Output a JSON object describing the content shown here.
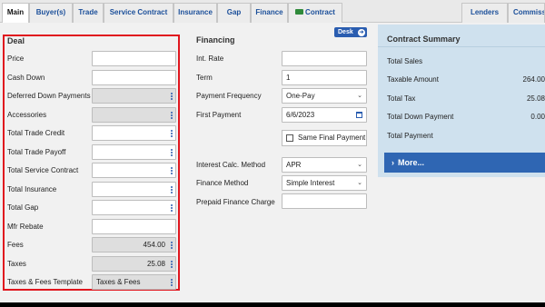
{
  "tabs": [
    {
      "label": "Main",
      "active": true
    },
    {
      "label": "Buyer(s)"
    },
    {
      "label": "Trade"
    },
    {
      "label": "Service Contract"
    },
    {
      "label": "Insurance"
    },
    {
      "label": "Gap"
    },
    {
      "label": "Finance"
    },
    {
      "label": "Contract",
      "icon": "money-icon"
    },
    {
      "label": "Lenders"
    },
    {
      "label": "Commissi"
    }
  ],
  "deal": {
    "title": "Deal",
    "rows": [
      {
        "label": "Price",
        "value": ""
      },
      {
        "label": "Cash Down",
        "value": ""
      },
      {
        "label": "Deferred Down Payments",
        "value": ""
      },
      {
        "label": "Accessories",
        "value": ""
      },
      {
        "label": "Total Trade Credit",
        "value": ""
      },
      {
        "label": "Total Trade Payoff",
        "value": ""
      },
      {
        "label": "Total Service Contract",
        "value": ""
      },
      {
        "label": "Total Insurance",
        "value": ""
      },
      {
        "label": "Total Gap",
        "value": ""
      },
      {
        "label": "Mfr Rebate",
        "value": ""
      },
      {
        "label": "Fees",
        "value": "454.00"
      },
      {
        "label": "Taxes",
        "value": "25.08"
      },
      {
        "label": "Taxes & Fees Template",
        "value": "Taxes & Fees"
      }
    ]
  },
  "financing": {
    "title": "Financing",
    "desk_label": "Desk",
    "int_rate": {
      "label": "Int. Rate",
      "value": ""
    },
    "term": {
      "label": "Term",
      "value": "1"
    },
    "payment_frequency": {
      "label": "Payment Frequency",
      "value": "One-Pay"
    },
    "first_payment": {
      "label": "First Payment",
      "value": "6/6/2023"
    },
    "same_final_payment": {
      "label": "Same Final Payment",
      "checked": false
    },
    "interest_calc_method": {
      "label": "Interest Calc. Method",
      "value": "APR"
    },
    "finance_method": {
      "label": "Finance Method",
      "value": "Simple Interest"
    },
    "prepaid_finance_charge": {
      "label": "Prepaid Finance Charge",
      "value": ""
    }
  },
  "summary": {
    "title": "Contract Summary",
    "rows": [
      {
        "label": "Total Sales",
        "value": ""
      },
      {
        "label": "Taxable Amount",
        "value": "264.00"
      },
      {
        "label": "Total Tax",
        "value": "25.08"
      },
      {
        "label": "Total Down Payment",
        "value": "0.00"
      },
      {
        "label": "Total Payment",
        "value": ""
      }
    ],
    "more_label": "More..."
  },
  "colors": {
    "accent": "#2a5db0",
    "highlight_border": "#e0161e",
    "summary_bg": "#cfe1ee"
  }
}
